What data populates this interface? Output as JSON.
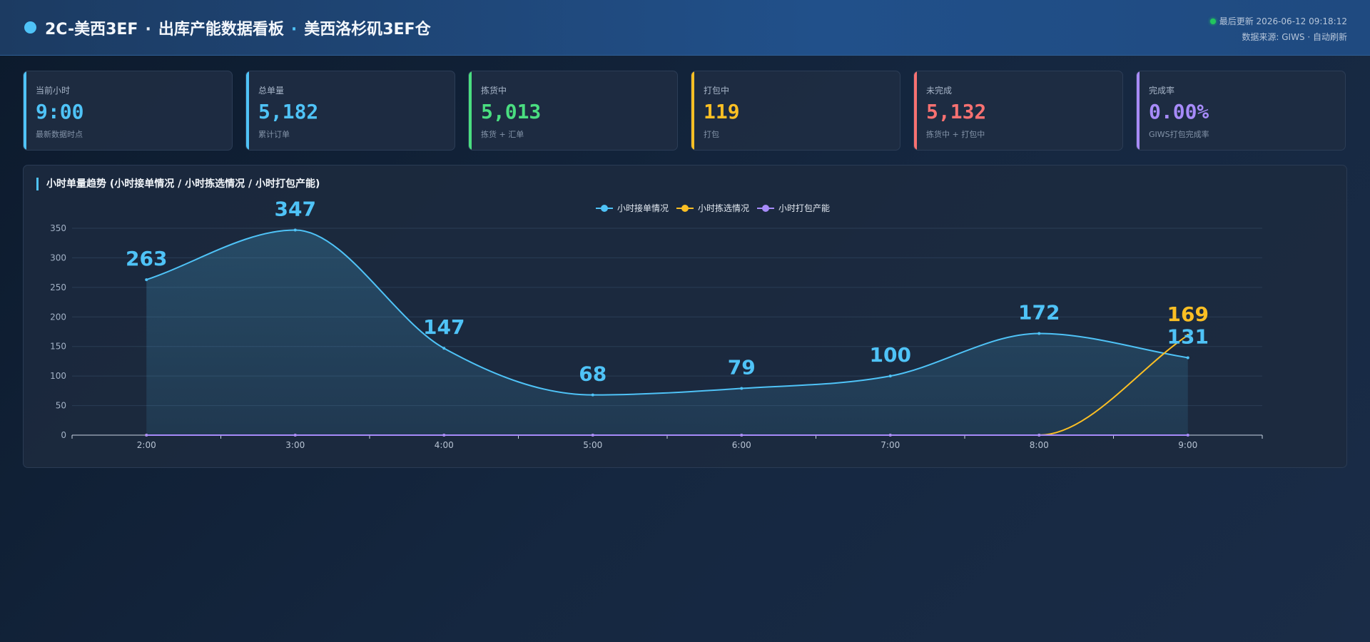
{
  "header": {
    "title_left": "2C-美西3EF",
    "title_mid": "出库产能数据看板",
    "title_right": "美西洛杉矶3EF仓",
    "sep": "·",
    "last_update": "最后更新 2026-06-12 09:18:12",
    "source": "数据来源: GIWS · 自动刷新"
  },
  "cards": [
    {
      "label": "当前小时",
      "value": "9:00",
      "sub": "最新数据时点",
      "color": "#4fc3f7"
    },
    {
      "label": "总单量",
      "value": "5,182",
      "sub": "累计订单",
      "color": "#4fc3f7"
    },
    {
      "label": "拣货中",
      "value": "5,013",
      "sub": "拣货 + 汇单",
      "color": "#4ade80"
    },
    {
      "label": "打包中",
      "value": "119",
      "sub": "打包",
      "color": "#fbbf24"
    },
    {
      "label": "未完成",
      "value": "5,132",
      "sub": "拣货中 + 打包中",
      "color": "#f87171"
    },
    {
      "label": "完成率",
      "value": "0.00%",
      "sub": "GIWS打包完成率",
      "color": "#a78bfa"
    }
  ],
  "chart_panel": {
    "title": "小时单量趋势 (小时接单情况 / 小时拣选情况 / 小时打包产能)"
  },
  "chart_data": {
    "type": "line",
    "x": [
      "2:00",
      "3:00",
      "4:00",
      "5:00",
      "6:00",
      "7:00",
      "8:00",
      "9:00"
    ],
    "ylim": [
      0,
      350
    ],
    "yticks": [
      0,
      50,
      100,
      150,
      200,
      250,
      300,
      350
    ],
    "grid": true,
    "legend_position": "top-center",
    "series": [
      {
        "name": "小时接单情况",
        "color": "#4fc3f7",
        "values": [
          263,
          347,
          147,
          68,
          79,
          100,
          172,
          131
        ],
        "area": true,
        "labels": [
          263,
          347,
          147,
          68,
          79,
          100,
          172,
          131
        ]
      },
      {
        "name": "小时拣选情况",
        "color": "#fbbf24",
        "values": [
          0,
          0,
          0,
          0,
          0,
          0,
          0,
          169
        ],
        "area": false,
        "labels": [
          null,
          null,
          null,
          null,
          null,
          null,
          null,
          169
        ]
      },
      {
        "name": "小时打包产能",
        "color": "#a78bfa",
        "values": [
          0,
          0,
          0,
          0,
          0,
          0,
          0,
          0
        ],
        "area": false,
        "labels": [
          null,
          null,
          null,
          null,
          null,
          null,
          null,
          null
        ]
      }
    ]
  }
}
